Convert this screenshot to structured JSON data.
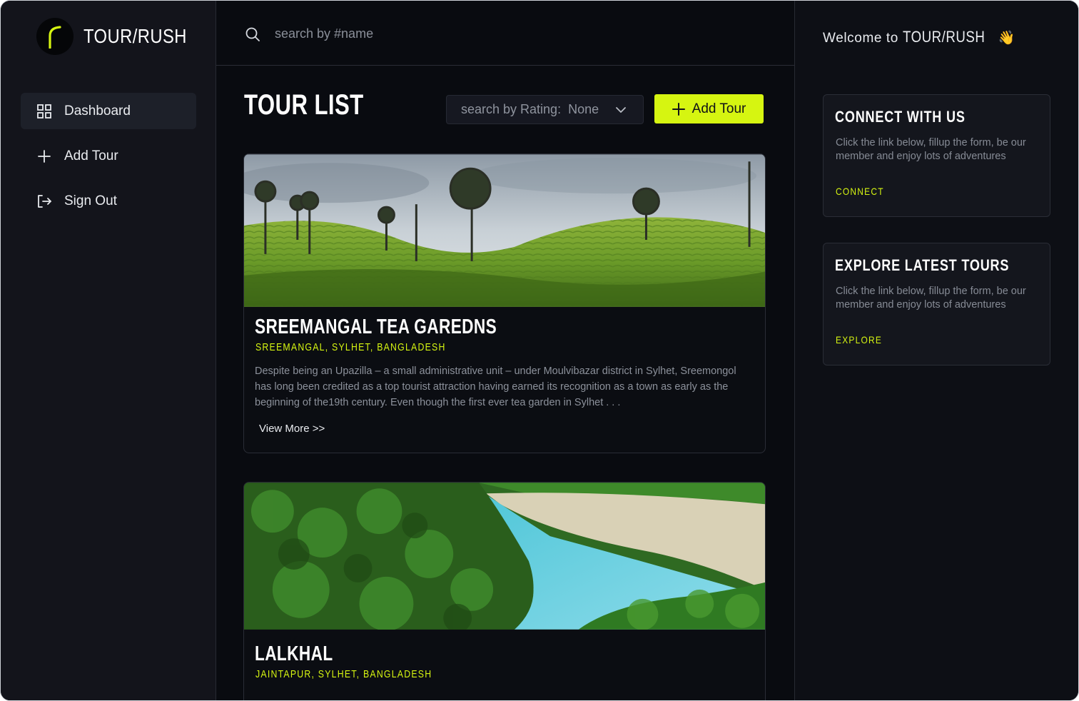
{
  "app": {
    "brand": "TOUR/RUSH",
    "accent": "#d6f511"
  },
  "sidebar": {
    "items": [
      {
        "label": "Dashboard",
        "icon": "grid-icon",
        "active": true
      },
      {
        "label": "Add Tour",
        "icon": "plus-icon"
      },
      {
        "label": "Sign Out",
        "icon": "sign-out-icon"
      }
    ]
  },
  "search": {
    "placeholder": "search by #name",
    "value": ""
  },
  "main": {
    "title": "TOUR LIST",
    "rating_filter": {
      "label": "search by Rating:",
      "value": "None"
    },
    "add_button": "Add Tour",
    "tours": [
      {
        "title": "SREEMANGAL TEA GAREDNS",
        "location": "SREEMANGAL, SYLHET, BANGLADESH",
        "description": "Despite being an Upazilla – a small administrative unit – under Moulvibazar district in Sylhet, Sreemongol has long been credited as a top tourist attraction having earned its recognition as a town as early as the beginning of the19th century. Even though the first ever tea garden in Sylhet . . .",
        "view_more": "View More  >>"
      },
      {
        "title": "LALKHAL",
        "location": "JAINTAPUR, SYLHET, BANGLADESH"
      }
    ]
  },
  "right": {
    "welcome_prefix": "Welcome to",
    "welcome_brand": "TOUR/RUSH",
    "welcome_emoji": "👋",
    "panels": [
      {
        "title": "CONNECT WITH US",
        "text": "Click the link below, fillup the form, be our member and enjoy lots of adventures",
        "link": "CONNECT"
      },
      {
        "title": "EXPLORE LATEST TOURS",
        "text": "Click the link below, fillup the form, be our member and enjoy lots of adventures",
        "link": "EXPLORE"
      }
    ]
  }
}
